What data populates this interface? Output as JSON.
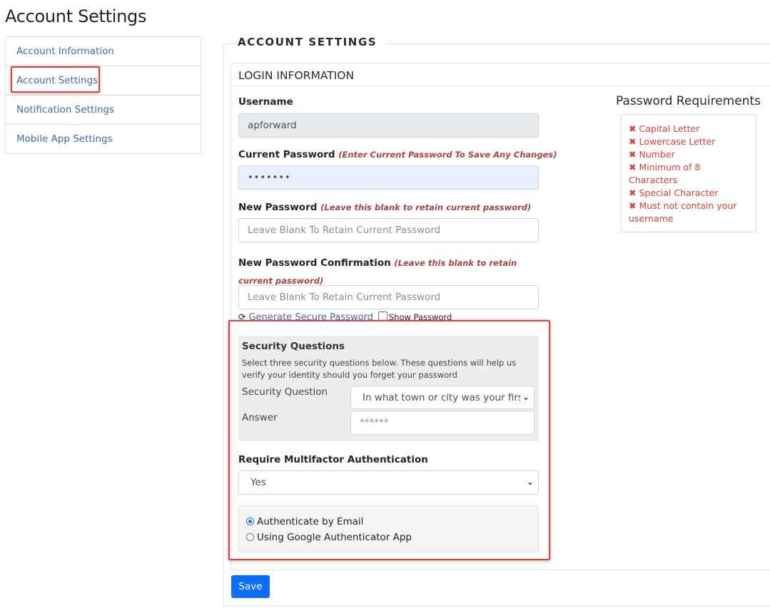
{
  "page_title": "Account Settings",
  "sidebar": {
    "items": [
      {
        "label": "Account Information"
      },
      {
        "label": "Account Settings"
      },
      {
        "label": "Notification Settings"
      },
      {
        "label": "Mobile App Settings"
      }
    ]
  },
  "panel": {
    "legend": "ACCOUNT SETTINGS",
    "section_title": "LOGIN INFORMATION"
  },
  "form": {
    "username_label": "Username",
    "username_value": "apforward",
    "current_password_label": "Current Password",
    "current_password_note": "(Enter Current Password To Save Any Changes)",
    "current_password_value": "•••••••",
    "new_password_label": "New Password",
    "new_password_note": "(Leave this blank to retain current password)",
    "new_password_placeholder": "Leave Blank To Retain Current Password",
    "confirm_label": "New Password Confirmation",
    "confirm_note": "(Leave this blank to retain current password)",
    "confirm_placeholder": "Leave Blank To Retain Current Password",
    "generate_link": "Generate Secure Password",
    "show_password": "Show Password"
  },
  "security": {
    "title": "Security Questions",
    "description": "Select three security questions below. These questions will help us verify your identity should you forget your password",
    "question_label": "Security Question",
    "question_value": "In what town or city was your first",
    "answer_label": "Answer",
    "answer_placeholder": "******"
  },
  "mfa": {
    "label": "Require Multifactor Authentication",
    "selected": "Yes",
    "option_email": "Authenticate by Email",
    "option_google": "Using Google Authenticator App",
    "selected_option": "email"
  },
  "save_label": "Save",
  "requirements": {
    "title": "Password Requirements",
    "items": [
      "Capital Letter",
      "Lowercase Letter",
      "Number",
      "Minimum of 8 Characters",
      "Special Character",
      "Must not contain your username"
    ]
  },
  "icons": {
    "refresh": "refresh-icon",
    "chevron": "chevron-down-icon",
    "cross": "x-icon"
  },
  "colors": {
    "link": "#3a6fa8",
    "highlight": "#e53e3e",
    "primary_button": "#0d6efd",
    "requirement_error": "#d9413a",
    "note": "#a94442"
  }
}
